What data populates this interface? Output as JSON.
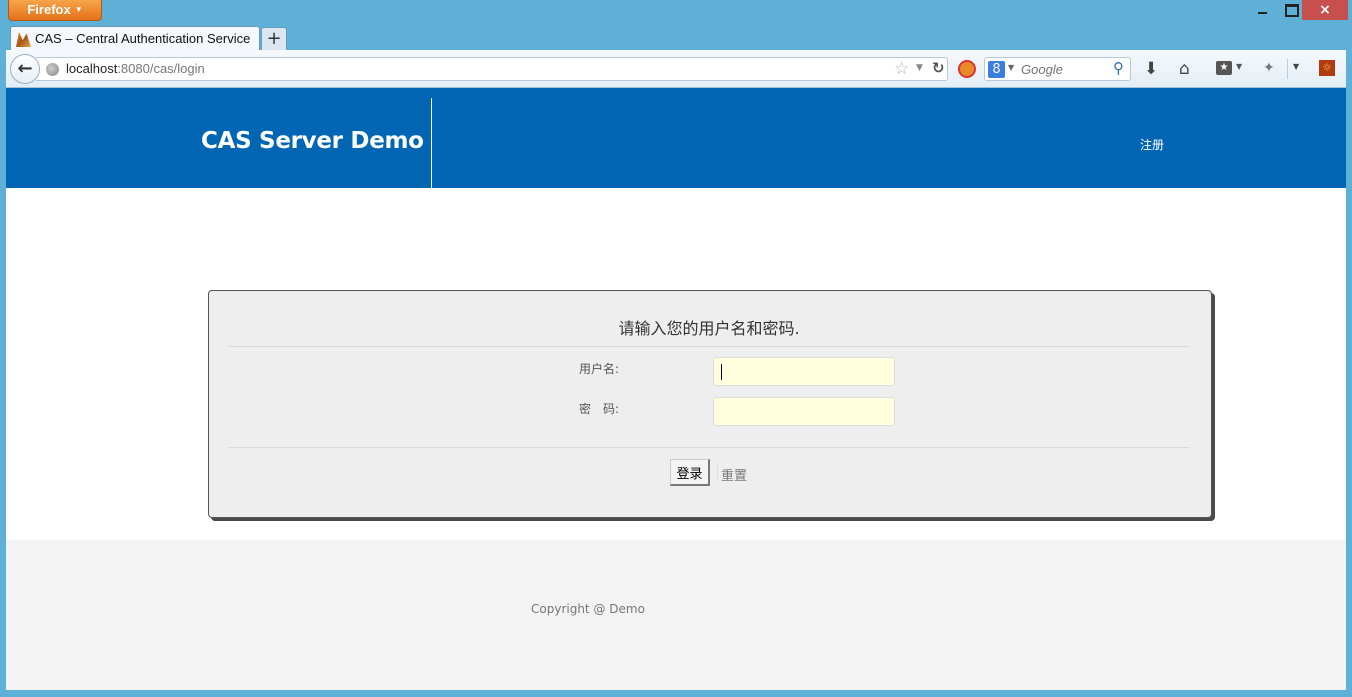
{
  "browser": {
    "app_button": "Firefox",
    "window_controls": {
      "minimize": "minimize",
      "maximize": "maximize",
      "close": "×"
    },
    "tabs": [
      {
        "title": "CAS – Central Authentication Service",
        "active": true
      }
    ],
    "new_tab_label": "+",
    "url": {
      "host": "localhost",
      "rest": ":8080/cas/login"
    },
    "search": {
      "placeholder": "Google",
      "engine": "8"
    },
    "icons": {
      "back": "←",
      "star": "☆",
      "dropmarker": "▼",
      "reload": "↻",
      "search_go": "⚲",
      "download": "⬇",
      "home": "⌂",
      "bookmarks": "★",
      "caret": "▼",
      "addon_fly": "✦",
      "addon_sun": "☼"
    }
  },
  "header": {
    "brand": "CAS Server Demo",
    "register_link": "注册",
    "colors": {
      "background": "#0066b3",
      "text": "#ffffff"
    }
  },
  "login": {
    "title": "请输入您的用户名和密码.",
    "username_label": "用户名:",
    "password_label": "密　码:",
    "username_value": "",
    "password_value": "",
    "submit_label": "登录",
    "reset_label": "重置",
    "input_background": "#ffffdd"
  },
  "footer": {
    "copyright": "Copyright @ Demo"
  }
}
